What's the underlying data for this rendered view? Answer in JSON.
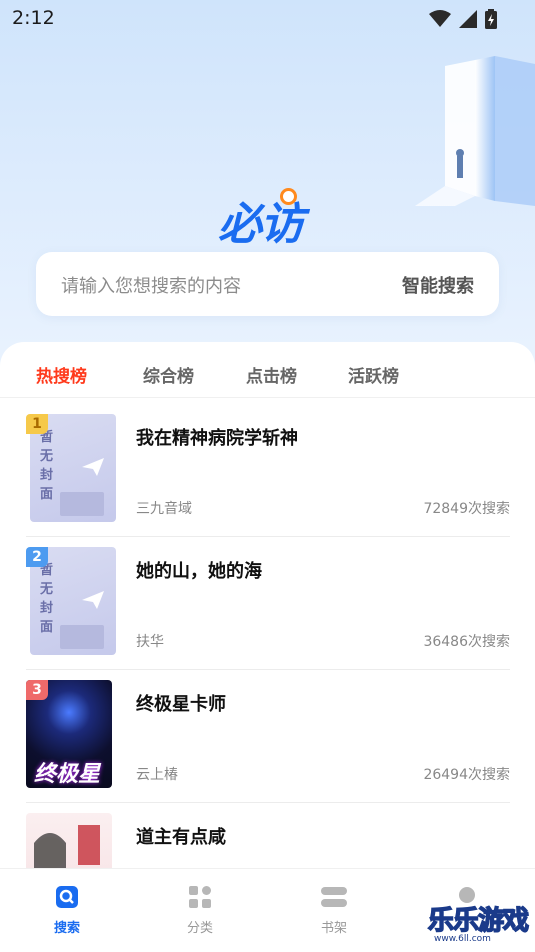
{
  "status_bar": {
    "time": "2:12",
    "icons": [
      "wifi-icon",
      "signal-icon",
      "battery-icon"
    ]
  },
  "logo_text": "必访",
  "search": {
    "placeholder": "请输入您想搜索的内容",
    "button_label": "智能搜索"
  },
  "tabs": [
    {
      "label": "热搜榜",
      "active": true
    },
    {
      "label": "综合榜",
      "active": false
    },
    {
      "label": "点击榜",
      "active": false
    },
    {
      "label": "活跃榜",
      "active": false
    }
  ],
  "no_cover_text": "暂无封面",
  "books": [
    {
      "rank": "1",
      "title": "我在精神病院学斩神",
      "author": "三九音域",
      "searches": "72849次搜索",
      "cover": "none"
    },
    {
      "rank": "2",
      "title": "她的山，她的海",
      "author": "扶华",
      "searches": "36486次搜索",
      "cover": "none"
    },
    {
      "rank": "3",
      "title": "终极星卡师",
      "author": "云上椿",
      "searches": "26494次搜索",
      "cover": "image",
      "cover_title": "终极星卡师"
    },
    {
      "rank": "",
      "title": "道主有点咸",
      "author": "",
      "searches": "",
      "cover": "image"
    }
  ],
  "bottom_nav": [
    {
      "label": "搜索",
      "icon": "search-icon",
      "active": true
    },
    {
      "label": "分类",
      "icon": "category-icon",
      "active": false
    },
    {
      "label": "书架",
      "icon": "bookshelf-icon",
      "active": false
    },
    {
      "label": "",
      "icon": "profile-icon",
      "active": false
    }
  ],
  "watermark": {
    "text": "乐乐游戏",
    "url": "www.6ll.com"
  },
  "colors": {
    "accent": "#1a6cf0",
    "active_tab": "#ff3a1c",
    "logo_dot": "#ff8a1e"
  }
}
